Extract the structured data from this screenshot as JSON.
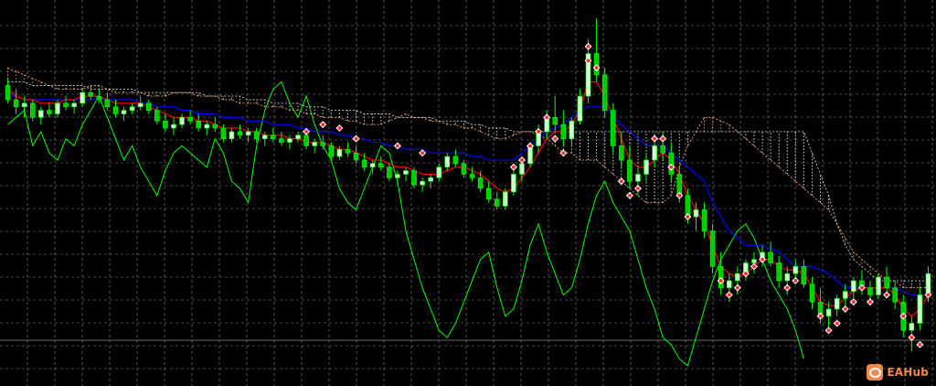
{
  "chart_data": {
    "type": "candlestick",
    "grid": true,
    "background": "#000000",
    "ylim": [
      0,
      100
    ],
    "colors": {
      "grid": "#8a8a8a",
      "candle_up": "#ccffcc",
      "candle_down": "#00cc00",
      "tenkan": "#ff0000",
      "kijun": "#0000ff",
      "chikou": "#00ff00",
      "cloud_a": "#f4a460",
      "cloud_b": "#ffffff",
      "signal_marker": "#ff3030"
    },
    "indicators": [
      "tenkan",
      "kijun",
      "chikou",
      "ichimoku-cloud"
    ],
    "candles": [
      {
        "o": 79,
        "h": 81,
        "l": 74,
        "c": 75
      },
      {
        "o": 75,
        "h": 78,
        "l": 71,
        "c": 73
      },
      {
        "o": 73,
        "h": 76,
        "l": 70,
        "c": 74
      },
      {
        "o": 74,
        "h": 75,
        "l": 69,
        "c": 70
      },
      {
        "o": 70,
        "h": 73,
        "l": 68,
        "c": 72
      },
      {
        "o": 72,
        "h": 74,
        "l": 70,
        "c": 71
      },
      {
        "o": 71,
        "h": 75,
        "l": 70,
        "c": 74
      },
      {
        "o": 74,
        "h": 76,
        "l": 72,
        "c": 73
      },
      {
        "o": 73,
        "h": 75,
        "l": 71,
        "c": 74
      },
      {
        "o": 74,
        "h": 78,
        "l": 73,
        "c": 77
      },
      {
        "o": 77,
        "h": 79,
        "l": 75,
        "c": 76
      },
      {
        "o": 76,
        "h": 78,
        "l": 74,
        "c": 75
      },
      {
        "o": 75,
        "h": 77,
        "l": 72,
        "c": 73
      },
      {
        "o": 73,
        "h": 75,
        "l": 70,
        "c": 71
      },
      {
        "o": 71,
        "h": 73,
        "l": 69,
        "c": 72
      },
      {
        "o": 72,
        "h": 74,
        "l": 71,
        "c": 73
      },
      {
        "o": 73,
        "h": 76,
        "l": 72,
        "c": 74
      },
      {
        "o": 74,
        "h": 75,
        "l": 71,
        "c": 72
      },
      {
        "o": 72,
        "h": 73,
        "l": 68,
        "c": 69
      },
      {
        "o": 69,
        "h": 71,
        "l": 66,
        "c": 67
      },
      {
        "o": 67,
        "h": 70,
        "l": 65,
        "c": 68
      },
      {
        "o": 68,
        "h": 71,
        "l": 67,
        "c": 70
      },
      {
        "o": 70,
        "h": 72,
        "l": 68,
        "c": 69
      },
      {
        "o": 69,
        "h": 71,
        "l": 66,
        "c": 67
      },
      {
        "o": 67,
        "h": 69,
        "l": 65,
        "c": 68
      },
      {
        "o": 68,
        "h": 70,
        "l": 66,
        "c": 67
      },
      {
        "o": 67,
        "h": 68,
        "l": 63,
        "c": 64
      },
      {
        "o": 64,
        "h": 67,
        "l": 63,
        "c": 66
      },
      {
        "o": 66,
        "h": 68,
        "l": 64,
        "c": 65
      },
      {
        "o": 65,
        "h": 67,
        "l": 63,
        "c": 66
      },
      {
        "o": 66,
        "h": 67,
        "l": 63,
        "c": 64
      },
      {
        "o": 64,
        "h": 66,
        "l": 62,
        "c": 65
      },
      {
        "o": 65,
        "h": 67,
        "l": 63,
        "c": 64
      },
      {
        "o": 64,
        "h": 66,
        "l": 62,
        "c": 63
      },
      {
        "o": 63,
        "h": 65,
        "l": 61,
        "c": 64
      },
      {
        "o": 64,
        "h": 66,
        "l": 63,
        "c": 65
      },
      {
        "o": 65,
        "h": 66,
        "l": 61,
        "c": 62
      },
      {
        "o": 62,
        "h": 64,
        "l": 60,
        "c": 63
      },
      {
        "o": 63,
        "h": 65,
        "l": 61,
        "c": 62
      },
      {
        "o": 62,
        "h": 63,
        "l": 58,
        "c": 59
      },
      {
        "o": 59,
        "h": 62,
        "l": 58,
        "c": 61
      },
      {
        "o": 61,
        "h": 63,
        "l": 59,
        "c": 60
      },
      {
        "o": 60,
        "h": 62,
        "l": 57,
        "c": 58
      },
      {
        "o": 58,
        "h": 60,
        "l": 55,
        "c": 56
      },
      {
        "o": 56,
        "h": 58,
        "l": 54,
        "c": 57
      },
      {
        "o": 57,
        "h": 59,
        "l": 55,
        "c": 56
      },
      {
        "o": 56,
        "h": 57,
        "l": 52,
        "c": 53
      },
      {
        "o": 53,
        "h": 55,
        "l": 51,
        "c": 54
      },
      {
        "o": 54,
        "h": 56,
        "l": 52,
        "c": 55
      },
      {
        "o": 55,
        "h": 56,
        "l": 50,
        "c": 51
      },
      {
        "o": 51,
        "h": 53,
        "l": 49,
        "c": 52
      },
      {
        "o": 52,
        "h": 54,
        "l": 50,
        "c": 53
      },
      {
        "o": 53,
        "h": 57,
        "l": 52,
        "c": 56
      },
      {
        "o": 56,
        "h": 60,
        "l": 55,
        "c": 59
      },
      {
        "o": 59,
        "h": 61,
        "l": 56,
        "c": 57
      },
      {
        "o": 57,
        "h": 58,
        "l": 53,
        "c": 54
      },
      {
        "o": 54,
        "h": 56,
        "l": 52,
        "c": 53
      },
      {
        "o": 53,
        "h": 55,
        "l": 49,
        "c": 50
      },
      {
        "o": 50,
        "h": 52,
        "l": 46,
        "c": 47
      },
      {
        "o": 47,
        "h": 49,
        "l": 44,
        "c": 45
      },
      {
        "o": 45,
        "h": 50,
        "l": 44,
        "c": 49
      },
      {
        "o": 49,
        "h": 55,
        "l": 48,
        "c": 54
      },
      {
        "o": 54,
        "h": 58,
        "l": 52,
        "c": 57
      },
      {
        "o": 57,
        "h": 63,
        "l": 56,
        "c": 62
      },
      {
        "o": 62,
        "h": 68,
        "l": 60,
        "c": 66
      },
      {
        "o": 66,
        "h": 72,
        "l": 64,
        "c": 70
      },
      {
        "o": 70,
        "h": 76,
        "l": 66,
        "c": 68
      },
      {
        "o": 68,
        "h": 72,
        "l": 62,
        "c": 64
      },
      {
        "o": 64,
        "h": 70,
        "l": 62,
        "c": 69
      },
      {
        "o": 69,
        "h": 78,
        "l": 68,
        "c": 76
      },
      {
        "o": 76,
        "h": 92,
        "l": 74,
        "c": 88
      },
      {
        "o": 88,
        "h": 98,
        "l": 80,
        "c": 82
      },
      {
        "o": 82,
        "h": 84,
        "l": 70,
        "c": 72
      },
      {
        "o": 72,
        "h": 74,
        "l": 60,
        "c": 62
      },
      {
        "o": 62,
        "h": 66,
        "l": 56,
        "c": 58
      },
      {
        "o": 58,
        "h": 62,
        "l": 50,
        "c": 52
      },
      {
        "o": 52,
        "h": 56,
        "l": 48,
        "c": 54
      },
      {
        "o": 54,
        "h": 60,
        "l": 52,
        "c": 58
      },
      {
        "o": 58,
        "h": 64,
        "l": 56,
        "c": 62
      },
      {
        "o": 62,
        "h": 66,
        "l": 58,
        "c": 60
      },
      {
        "o": 60,
        "h": 63,
        "l": 52,
        "c": 54
      },
      {
        "o": 54,
        "h": 56,
        "l": 46,
        "c": 48
      },
      {
        "o": 48,
        "h": 50,
        "l": 40,
        "c": 42
      },
      {
        "o": 42,
        "h": 46,
        "l": 38,
        "c": 44
      },
      {
        "o": 44,
        "h": 46,
        "l": 36,
        "c": 38
      },
      {
        "o": 38,
        "h": 40,
        "l": 26,
        "c": 28
      },
      {
        "o": 28,
        "h": 32,
        "l": 20,
        "c": 22
      },
      {
        "o": 22,
        "h": 26,
        "l": 18,
        "c": 24
      },
      {
        "o": 24,
        "h": 28,
        "l": 20,
        "c": 26
      },
      {
        "o": 26,
        "h": 30,
        "l": 24,
        "c": 29
      },
      {
        "o": 29,
        "h": 32,
        "l": 26,
        "c": 30
      },
      {
        "o": 30,
        "h": 34,
        "l": 28,
        "c": 32
      },
      {
        "o": 32,
        "h": 35,
        "l": 28,
        "c": 29
      },
      {
        "o": 29,
        "h": 31,
        "l": 22,
        "c": 24
      },
      {
        "o": 24,
        "h": 28,
        "l": 20,
        "c": 26
      },
      {
        "o": 26,
        "h": 30,
        "l": 24,
        "c": 28
      },
      {
        "o": 28,
        "h": 30,
        "l": 22,
        "c": 23
      },
      {
        "o": 23,
        "h": 25,
        "l": 16,
        "c": 18
      },
      {
        "o": 18,
        "h": 22,
        "l": 12,
        "c": 14
      },
      {
        "o": 14,
        "h": 18,
        "l": 10,
        "c": 16
      },
      {
        "o": 16,
        "h": 20,
        "l": 14,
        "c": 19
      },
      {
        "o": 19,
        "h": 23,
        "l": 17,
        "c": 21
      },
      {
        "o": 21,
        "h": 25,
        "l": 19,
        "c": 24
      },
      {
        "o": 24,
        "h": 27,
        "l": 20,
        "c": 22
      },
      {
        "o": 22,
        "h": 24,
        "l": 18,
        "c": 20
      },
      {
        "o": 20,
        "h": 26,
        "l": 19,
        "c": 25
      },
      {
        "o": 25,
        "h": 28,
        "l": 21,
        "c": 22
      },
      {
        "o": 22,
        "h": 24,
        "l": 16,
        "c": 18
      },
      {
        "o": 18,
        "h": 20,
        "l": 8,
        "c": 10
      },
      {
        "o": 10,
        "h": 14,
        "l": 4,
        "c": 12
      },
      {
        "o": 12,
        "h": 22,
        "l": 10,
        "c": 20
      },
      {
        "o": 20,
        "h": 28,
        "l": 18,
        "c": 26
      }
    ],
    "tenkan": [
      78,
      76,
      75,
      75,
      74,
      74,
      74,
      75,
      75,
      76,
      76,
      76,
      75,
      74,
      74,
      74,
      74,
      73,
      72,
      71,
      70,
      70,
      70,
      69,
      69,
      68,
      67,
      67,
      67,
      66,
      66,
      65,
      65,
      65,
      64,
      64,
      63,
      63,
      63,
      62,
      61,
      61,
      60,
      59,
      58,
      58,
      57,
      56,
      56,
      55,
      54,
      54,
      54,
      55,
      56,
      56,
      55,
      54,
      52,
      50,
      49,
      50,
      53,
      56,
      60,
      64,
      66,
      66,
      68,
      72,
      80,
      80,
      76,
      70,
      64,
      58,
      56,
      56,
      58,
      60,
      58,
      54,
      48,
      44,
      40,
      34,
      28,
      26,
      25,
      26,
      28,
      30,
      30,
      28,
      27,
      27,
      26,
      22,
      18,
      17,
      17,
      19,
      21,
      22,
      22,
      22,
      22,
      20,
      16,
      14,
      16,
      20
    ],
    "kijun": [
      76,
      76,
      75,
      75,
      75,
      75,
      75,
      75,
      75,
      75,
      75,
      75,
      75,
      75,
      75,
      75,
      74,
      74,
      73,
      73,
      73,
      72,
      72,
      71,
      71,
      71,
      70,
      70,
      70,
      69,
      69,
      69,
      68,
      68,
      68,
      67,
      67,
      66,
      66,
      66,
      65,
      65,
      64,
      64,
      63,
      63,
      62,
      62,
      61,
      61,
      61,
      60,
      60,
      60,
      60,
      60,
      59,
      59,
      58,
      58,
      58,
      58,
      60,
      62,
      64,
      66,
      67,
      68,
      70,
      72,
      73,
      73,
      73,
      70,
      68,
      66,
      64,
      62,
      62,
      62,
      60,
      58,
      56,
      54,
      52,
      46,
      42,
      38,
      36,
      34,
      34,
      34,
      33,
      32,
      30,
      28,
      28,
      28,
      27,
      26,
      24,
      22,
      22,
      22,
      22,
      22,
      22,
      22,
      21,
      20,
      20,
      20
    ],
    "chikou": [
      68,
      70,
      72,
      62,
      66,
      60,
      58,
      64,
      62,
      68,
      72,
      76,
      70,
      64,
      58,
      62,
      56,
      52,
      48,
      55,
      60,
      62,
      60,
      58,
      56,
      64,
      60,
      52,
      50,
      46,
      62,
      72,
      78,
      80,
      74,
      70,
      76,
      68,
      62,
      58,
      50,
      46,
      44,
      50,
      56,
      62,
      60,
      52,
      38,
      30,
      22,
      16,
      10,
      8,
      12,
      18,
      24,
      30,
      32,
      22,
      14,
      16,
      24,
      34,
      40,
      32,
      26,
      20,
      22,
      30,
      40,
      48,
      52,
      46,
      42,
      38,
      30,
      22,
      16,
      8,
      6,
      2,
      0,
      8,
      16,
      24,
      30,
      34,
      38,
      40,
      36,
      30,
      24,
      20,
      16,
      10,
      2
    ],
    "cloud_a": [
      84,
      83,
      82,
      81,
      80,
      79,
      78,
      78,
      78,
      78,
      79,
      79,
      78,
      77,
      77,
      77,
      77,
      76,
      76,
      76,
      77,
      77,
      77,
      76,
      76,
      76,
      75,
      75,
      74,
      74,
      74,
      73,
      73,
      73,
      72,
      72,
      71,
      71,
      70,
      70,
      70,
      69,
      69,
      68,
      68,
      68,
      69,
      70,
      71,
      70,
      70,
      69,
      69,
      68,
      68,
      67,
      67,
      66,
      65,
      64,
      64,
      65,
      66,
      66,
      65,
      64,
      62,
      60,
      60,
      58,
      58,
      58,
      56,
      54,
      52,
      50,
      48,
      46,
      46,
      46,
      48,
      56,
      62,
      66,
      70,
      70,
      69,
      68,
      66,
      64,
      62,
      60,
      58,
      56,
      54,
      52,
      50,
      48,
      46,
      44,
      40,
      36,
      32,
      30,
      28,
      26,
      24,
      24,
      22,
      22,
      22,
      22
    ],
    "cloud_b": [
      80,
      80,
      80,
      79,
      79,
      79,
      79,
      79,
      79,
      79,
      78,
      78,
      78,
      78,
      78,
      78,
      77,
      77,
      77,
      77,
      77,
      77,
      77,
      77,
      76,
      76,
      76,
      76,
      76,
      75,
      75,
      75,
      74,
      74,
      74,
      74,
      73,
      73,
      73,
      72,
      72,
      72,
      72,
      71,
      71,
      71,
      71,
      70,
      70,
      70,
      70,
      70,
      69,
      69,
      69,
      69,
      68,
      68,
      67,
      67,
      67,
      66,
      66,
      66,
      66,
      66,
      66,
      66,
      66,
      66,
      66,
      66,
      66,
      66,
      66,
      66,
      66,
      66,
      66,
      66,
      66,
      66,
      66,
      66,
      66,
      66,
      66,
      66,
      66,
      66,
      66,
      66,
      66,
      66,
      66,
      66,
      66,
      60,
      54,
      48,
      40,
      34,
      30,
      28,
      26,
      24,
      24,
      24,
      24,
      24,
      24,
      24
    ],
    "signal_markers": [
      {
        "i": 36,
        "v": 66
      },
      {
        "i": 38,
        "v": 68
      },
      {
        "i": 40,
        "v": 67
      },
      {
        "i": 42,
        "v": 64
      },
      {
        "i": 47,
        "v": 62
      },
      {
        "i": 50,
        "v": 60
      },
      {
        "i": 61,
        "v": 56
      },
      {
        "i": 62,
        "v": 58
      },
      {
        "i": 63,
        "v": 62
      },
      {
        "i": 64,
        "v": 66
      },
      {
        "i": 65,
        "v": 70
      },
      {
        "i": 66,
        "v": 64
      },
      {
        "i": 67,
        "v": 60
      },
      {
        "i": 70,
        "v": 90
      },
      {
        "i": 70,
        "v": 86
      },
      {
        "i": 71,
        "v": 84
      },
      {
        "i": 74,
        "v": 52
      },
      {
        "i": 75,
        "v": 48
      },
      {
        "i": 76,
        "v": 50
      },
      {
        "i": 78,
        "v": 64
      },
      {
        "i": 79,
        "v": 64
      },
      {
        "i": 80,
        "v": 56
      },
      {
        "i": 81,
        "v": 48
      },
      {
        "i": 82,
        "v": 42
      },
      {
        "i": 86,
        "v": 24
      },
      {
        "i": 87,
        "v": 20
      },
      {
        "i": 88,
        "v": 22
      },
      {
        "i": 89,
        "v": 26
      },
      {
        "i": 90,
        "v": 28
      },
      {
        "i": 91,
        "v": 30
      },
      {
        "i": 94,
        "v": 22
      },
      {
        "i": 95,
        "v": 24
      },
      {
        "i": 98,
        "v": 14
      },
      {
        "i": 99,
        "v": 10
      },
      {
        "i": 100,
        "v": 12
      },
      {
        "i": 101,
        "v": 16
      },
      {
        "i": 102,
        "v": 18
      },
      {
        "i": 103,
        "v": 22
      },
      {
        "i": 104,
        "v": 18
      },
      {
        "i": 106,
        "v": 20
      },
      {
        "i": 108,
        "v": 14
      },
      {
        "i": 109,
        "v": 8
      },
      {
        "i": 110,
        "v": 6
      },
      {
        "i": 111,
        "v": 20
      }
    ]
  },
  "watermark": {
    "text": "EAHub"
  }
}
